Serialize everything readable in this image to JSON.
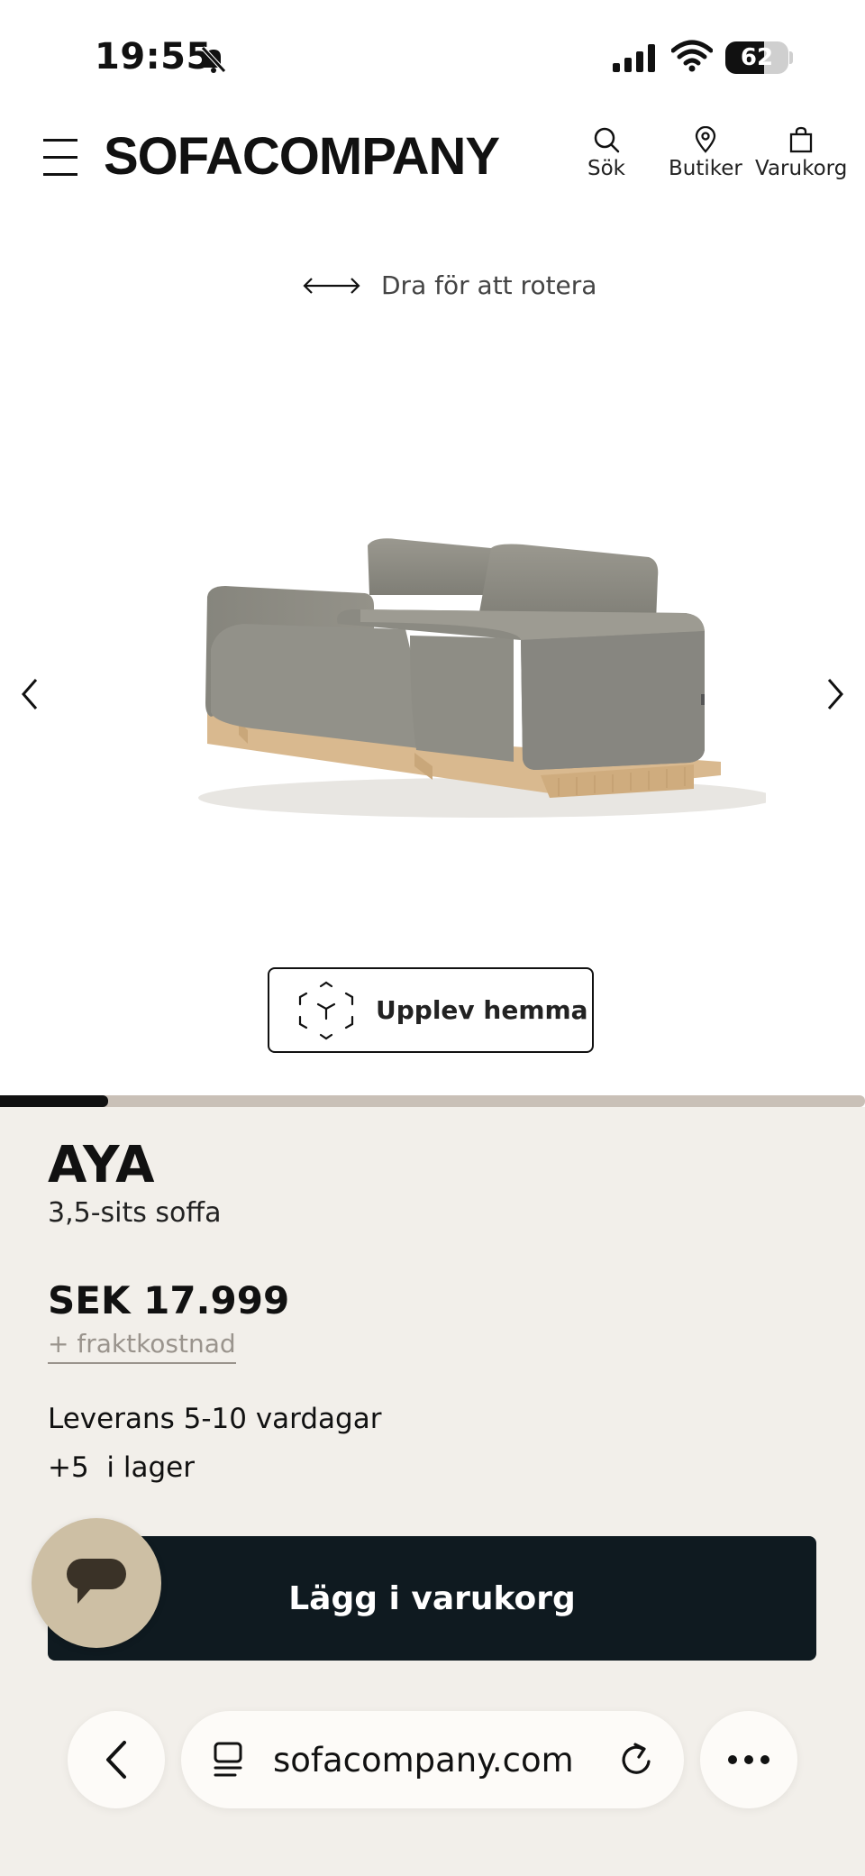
{
  "status_bar": {
    "time": "19:55",
    "battery_percent": "62",
    "battery_level": 0.62,
    "icons": [
      "bell-slash-icon",
      "cellular-signal-icon",
      "wifi-icon",
      "battery-icon"
    ]
  },
  "header": {
    "logo": "SOFACOMPANY",
    "menu_icon": "hamburger-menu-icon",
    "actions": [
      {
        "label": "Sök",
        "icon": "search-icon"
      },
      {
        "label": "Butiker",
        "icon": "location-pin-icon"
      },
      {
        "label": "Varukorg",
        "icon": "shopping-bag-icon"
      }
    ]
  },
  "viewer": {
    "rotate_hint": "Dra för att rotera",
    "image_alt": "Sofa",
    "prev_icon": "chevron-left-icon",
    "next_icon": "chevron-right-icon",
    "ar_button_label": "Upplev hemma",
    "ar_icon": "ar-cube-icon",
    "gallery_progress": 0.125
  },
  "product": {
    "name": "AYA",
    "subtitle": "3,5-sits soffa",
    "price": "SEK 17.999",
    "shipping_link": "+ fraktkostnad",
    "delivery": "Leverans 5-10 vardagar",
    "stock": "+5  i lager",
    "add_to_cart": "Lägg i varukorg"
  },
  "chat": {
    "icon": "chat-bubble-icon"
  },
  "browser_bar": {
    "url": "sofacompany.com",
    "back_icon": "chevron-left-icon",
    "tabs_icon": "page-menu-icon",
    "reload_icon": "reload-icon",
    "more_icon": "more-dots-icon"
  },
  "colors": {
    "panel_bg": "#f2efea",
    "cart_button_bg": "#0f1a20",
    "chat_fab_bg": "#cdbfa4",
    "progress_track": "#c9c0b7",
    "sofa_fabric": "#8d8c84",
    "sofa_wood": "#d9b98f"
  }
}
